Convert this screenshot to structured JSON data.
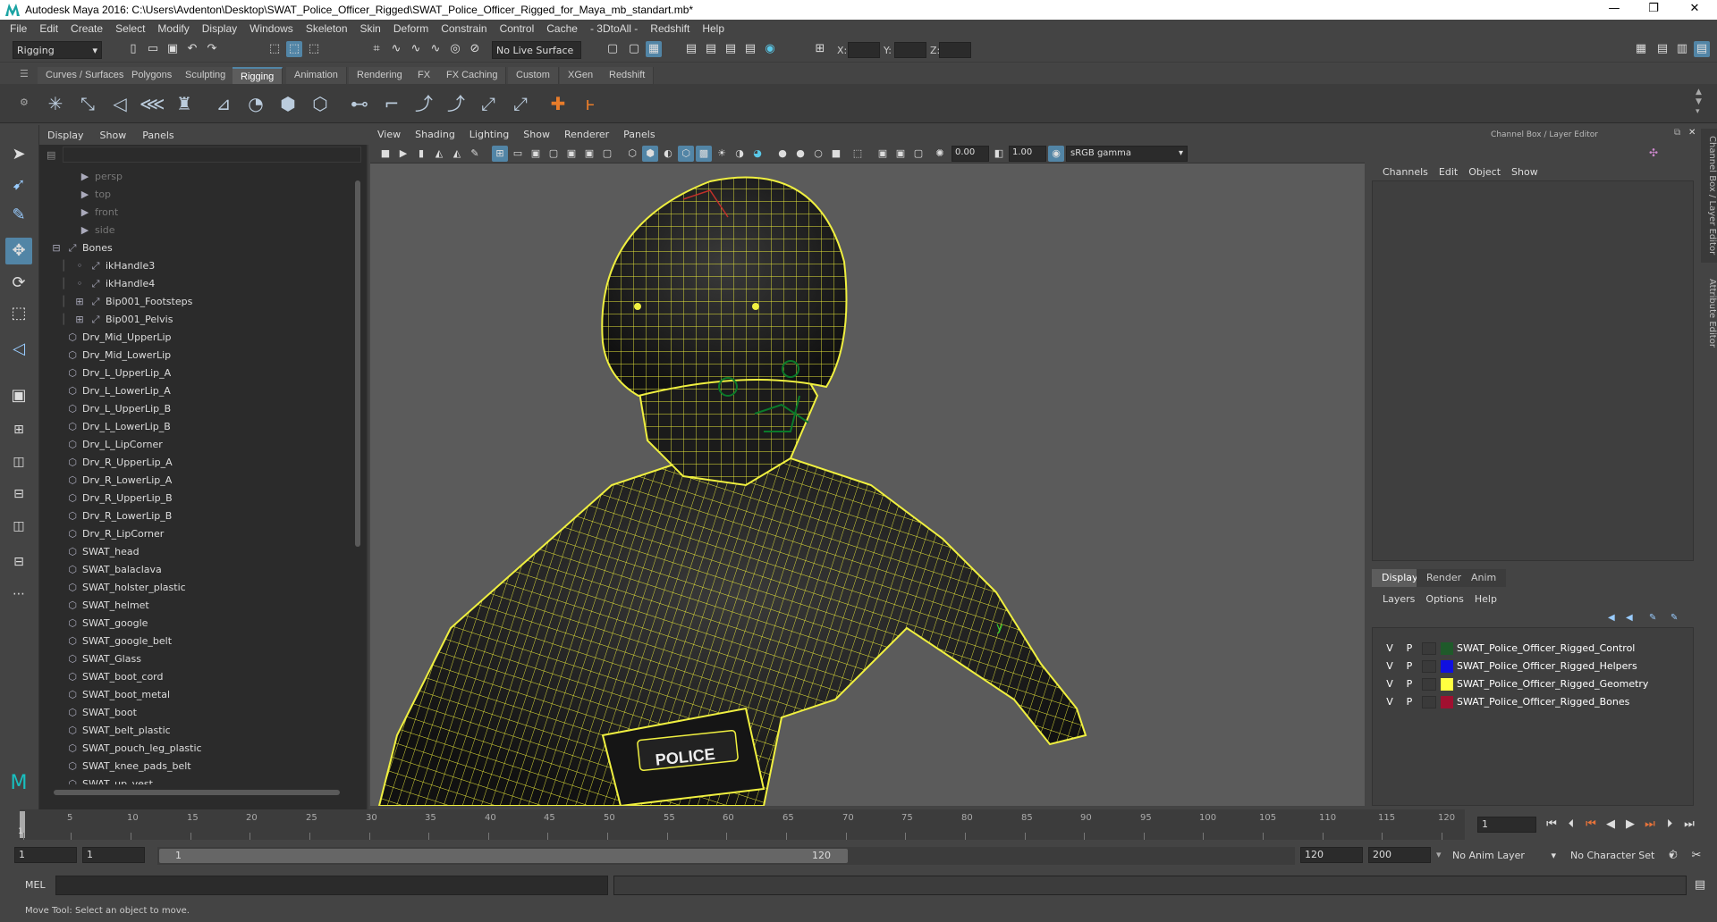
{
  "window": {
    "title": "Autodesk Maya 2016: C:\\Users\\Avdenton\\Desktop\\SWAT_Police_Officer_Rigged\\SWAT_Police_Officer_Rigged_for_Maya_mb_standart.mb*",
    "minimize": "—",
    "maximize": "❐",
    "close": "✕"
  },
  "menubar": [
    "File",
    "Edit",
    "Create",
    "Select",
    "Modify",
    "Display",
    "Windows",
    "Skeleton",
    "Skin",
    "Deform",
    "Constrain",
    "Control",
    "Cache",
    "- 3DtoAll -",
    "Redshift",
    "Help"
  ],
  "statusline": {
    "menu_set": "Rigging",
    "live_surface": "No Live Surface",
    "x_label": "X:",
    "y_label": "Y:",
    "z_label": "Z:"
  },
  "shelf": {
    "tabs": [
      "Curves / Surfaces",
      "Polygons",
      "Sculpting",
      "Rigging",
      "Animation",
      "Rendering",
      "FX",
      "FX Caching",
      "Custom",
      "XGen",
      "Redshift"
    ],
    "active_tab": "Rigging"
  },
  "outliner": {
    "menu": [
      "Display",
      "Show",
      "Panels"
    ],
    "items": [
      {
        "label": "persp",
        "type": "camera",
        "dim": true
      },
      {
        "label": "top",
        "type": "camera",
        "dim": true
      },
      {
        "label": "front",
        "type": "camera",
        "dim": true
      },
      {
        "label": "side",
        "type": "camera",
        "dim": true
      },
      {
        "label": "Bones",
        "type": "joint-group",
        "expanded": true
      },
      {
        "label": "ikHandle3",
        "type": "ik",
        "child": true
      },
      {
        "label": "ikHandle4",
        "type": "ik",
        "child": true
      },
      {
        "label": "Bip001_Footsteps",
        "type": "joint",
        "child": true,
        "expandable": true
      },
      {
        "label": "Bip001_Pelvis",
        "type": "joint",
        "child": true,
        "expandable": true
      },
      {
        "label": "Drv_Mid_UpperLip",
        "type": "mesh"
      },
      {
        "label": "Drv_Mid_LowerLip",
        "type": "mesh"
      },
      {
        "label": "Drv_L_UpperLip_A",
        "type": "mesh"
      },
      {
        "label": "Drv_L_LowerLip_A",
        "type": "mesh"
      },
      {
        "label": "Drv_L_UpperLip_B",
        "type": "mesh"
      },
      {
        "label": "Drv_L_LowerLip_B",
        "type": "mesh"
      },
      {
        "label": "Drv_L_LipCorner",
        "type": "mesh"
      },
      {
        "label": "Drv_R_UpperLip_A",
        "type": "mesh"
      },
      {
        "label": "Drv_R_LowerLip_A",
        "type": "mesh"
      },
      {
        "label": "Drv_R_UpperLip_B",
        "type": "mesh"
      },
      {
        "label": "Drv_R_LowerLip_B",
        "type": "mesh"
      },
      {
        "label": "Drv_R_LipCorner",
        "type": "mesh"
      },
      {
        "label": "SWAT_head",
        "type": "mesh"
      },
      {
        "label": "SWAT_balaclava",
        "type": "mesh"
      },
      {
        "label": "SWAT_holster_plastic",
        "type": "mesh"
      },
      {
        "label": "SWAT_helmet",
        "type": "mesh"
      },
      {
        "label": "SWAT_google",
        "type": "mesh"
      },
      {
        "label": "SWAT_google_belt",
        "type": "mesh"
      },
      {
        "label": "SWAT_Glass",
        "type": "mesh"
      },
      {
        "label": "SWAT_boot_cord",
        "type": "mesh"
      },
      {
        "label": "SWAT_boot_metal",
        "type": "mesh"
      },
      {
        "label": "SWAT_boot",
        "type": "mesh"
      },
      {
        "label": "SWAT_belt_plastic",
        "type": "mesh"
      },
      {
        "label": "SWAT_pouch_leg_plastic",
        "type": "mesh"
      },
      {
        "label": "SWAT_knee_pads_belt",
        "type": "mesh"
      },
      {
        "label": "SWAT_up_vest",
        "type": "mesh"
      }
    ]
  },
  "viewport": {
    "menu": [
      "View",
      "Shading",
      "Lighting",
      "Show",
      "Renderer",
      "Panels"
    ],
    "exposure": "0.00",
    "gamma": "1.00",
    "color_space": "sRGB gamma",
    "badge_text": "POLICE",
    "axis_label": "y"
  },
  "channelbox": {
    "title": "Channel Box / Layer Editor",
    "menu": [
      "Channels",
      "Edit",
      "Object",
      "Show"
    ],
    "layer_tabs": [
      "Display",
      "Render",
      "Anim"
    ],
    "active_layer_tab": "Display",
    "layer_menu": [
      "Layers",
      "Options",
      "Help"
    ],
    "layers": [
      {
        "v": "V",
        "p": "P",
        "name": "SWAT_Police_Officer_Rigged_Control",
        "color": "#1f5a2a"
      },
      {
        "v": "V",
        "p": "P",
        "name": "SWAT_Police_Officer_Rigged_Helpers",
        "color": "#1010e0"
      },
      {
        "v": "V",
        "p": "P",
        "name": "SWAT_Police_Officer_Rigged_Geometry",
        "color": "#ffff40"
      },
      {
        "v": "V",
        "p": "P",
        "name": "SWAT_Police_Officer_Rigged_Bones",
        "color": "#a01030"
      }
    ],
    "side_tabs": [
      "Channel Box / Layer Editor",
      "Attribute Editor"
    ]
  },
  "timeslider": {
    "ticks": [
      1,
      5,
      10,
      15,
      20,
      25,
      30,
      35,
      40,
      45,
      50,
      55,
      60,
      65,
      70,
      75,
      80,
      85,
      90,
      95,
      100,
      105,
      110,
      115,
      120
    ],
    "current_frame": "1",
    "current_marker": "1"
  },
  "range": {
    "start": "1",
    "playback_start": "1",
    "inner_start": "1",
    "inner_end": "120",
    "playback_end": "120",
    "end": "200",
    "anim_layer": "No Anim Layer",
    "character_set": "No Character Set"
  },
  "cmdline": {
    "label": "MEL"
  },
  "helpline": {
    "text": "Move Tool: Select an object to move."
  }
}
